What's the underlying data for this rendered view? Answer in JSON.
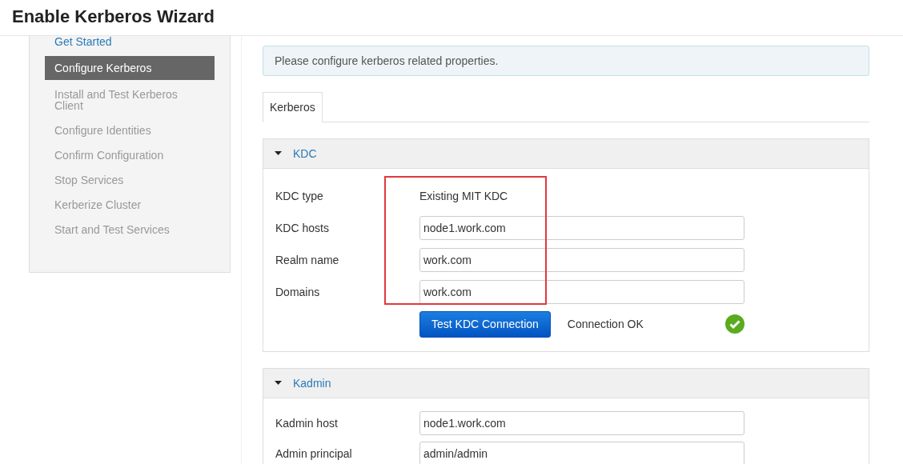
{
  "header": {
    "title": "Enable Kerberos Wizard"
  },
  "steps": [
    {
      "label": "Get Started",
      "completed": true,
      "selected": false
    },
    {
      "label": "Configure Kerberos",
      "completed": false,
      "selected": true
    },
    {
      "label": "Install and Test Kerberos Client",
      "completed": false,
      "selected": false
    },
    {
      "label": "Configure Identities",
      "completed": false,
      "selected": false
    },
    {
      "label": "Confirm Configuration",
      "completed": false,
      "selected": false
    },
    {
      "label": "Stop Services",
      "completed": false,
      "selected": false
    },
    {
      "label": "Kerberize Cluster",
      "completed": false,
      "selected": false
    },
    {
      "label": "Start and Test Services",
      "completed": false,
      "selected": false
    }
  ],
  "alert": "Please configure kerberos related properties.",
  "tabs": [
    {
      "label": "Kerberos",
      "selected": true
    }
  ],
  "sections": [
    {
      "title": "KDC",
      "expanded": true,
      "highlighted": true,
      "fields": [
        {
          "kind": "text",
          "label": "KDC type",
          "value": "Existing MIT KDC"
        },
        {
          "kind": "input",
          "label": "KDC hosts",
          "value": "node1.work.com"
        },
        {
          "kind": "input",
          "label": "Realm name",
          "value": "work.com"
        },
        {
          "kind": "input",
          "label": "Domains",
          "value": "work.com"
        }
      ],
      "test": {
        "button": "Test KDC Connection",
        "result": "Connection OK",
        "ok": true
      }
    },
    {
      "title": "Kadmin",
      "expanded": true,
      "highlighted": false,
      "fields": [
        {
          "kind": "input",
          "label": "Kadmin host",
          "value": "node1.work.com"
        },
        {
          "kind": "input",
          "label": "Admin principal",
          "value": "admin/admin"
        }
      ]
    }
  ]
}
